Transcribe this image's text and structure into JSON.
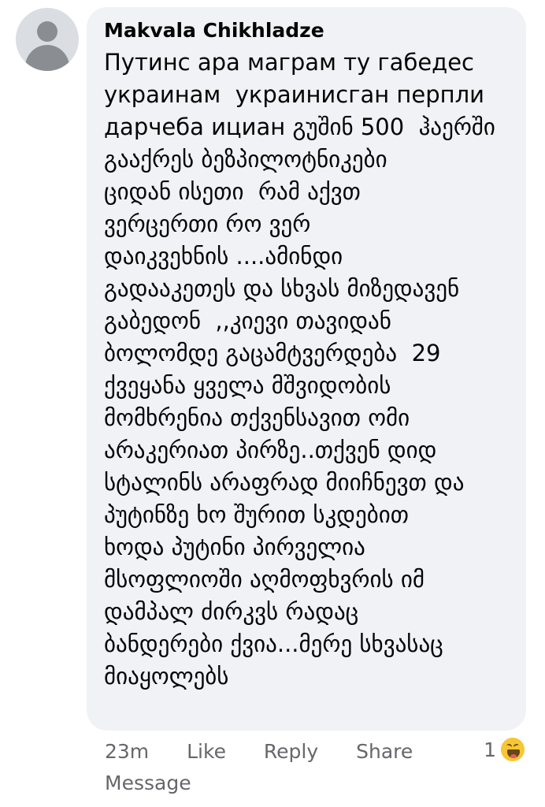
{
  "comment": {
    "author": "Makvala Chikhladze",
    "lines": [
      "Путинс ара маграм ту габедес",
      "украинам  украинисган перпли",
      "дарчеба ициан გუშინ 500  ჰაერში",
      "გააქრეს ბეზპილოტნიკები",
      "ციდან ისეთი  რამ აქვთ",
      "ვერცერთი რო ვერ",
      "დაიკვეხნის ....ამინდი",
      "გადააკეთეს და სხვას მიზედავენ",
      "გაბედონ  ,,კიევი თავიდან",
      "ბოლომდე გაცამტვერდება  29",
      "ქვეყანა ყველა მშვიდობის",
      "მომხრენია თქვენსავით ომი",
      "არაკერიათ პირზე..თქვენ დიდ",
      "სტალინს არაფრად მიიჩნევთ და",
      "პუტინზე ხო შურით სკდებით",
      "ხოდა პუტინი პირველია",
      "მსოფლიოში აღმოფხვრის იმ",
      "დამპალ ძირკვს რადაც",
      "ბანდერები ქვია...მერე სხვასაც",
      "მიაყოლებს"
    ]
  },
  "actions": {
    "time": "23m",
    "like": "Like",
    "reply": "Reply",
    "share": "Share",
    "message": "Message"
  },
  "reactions": {
    "count": "1",
    "icon": "haha-emoji-icon"
  }
}
